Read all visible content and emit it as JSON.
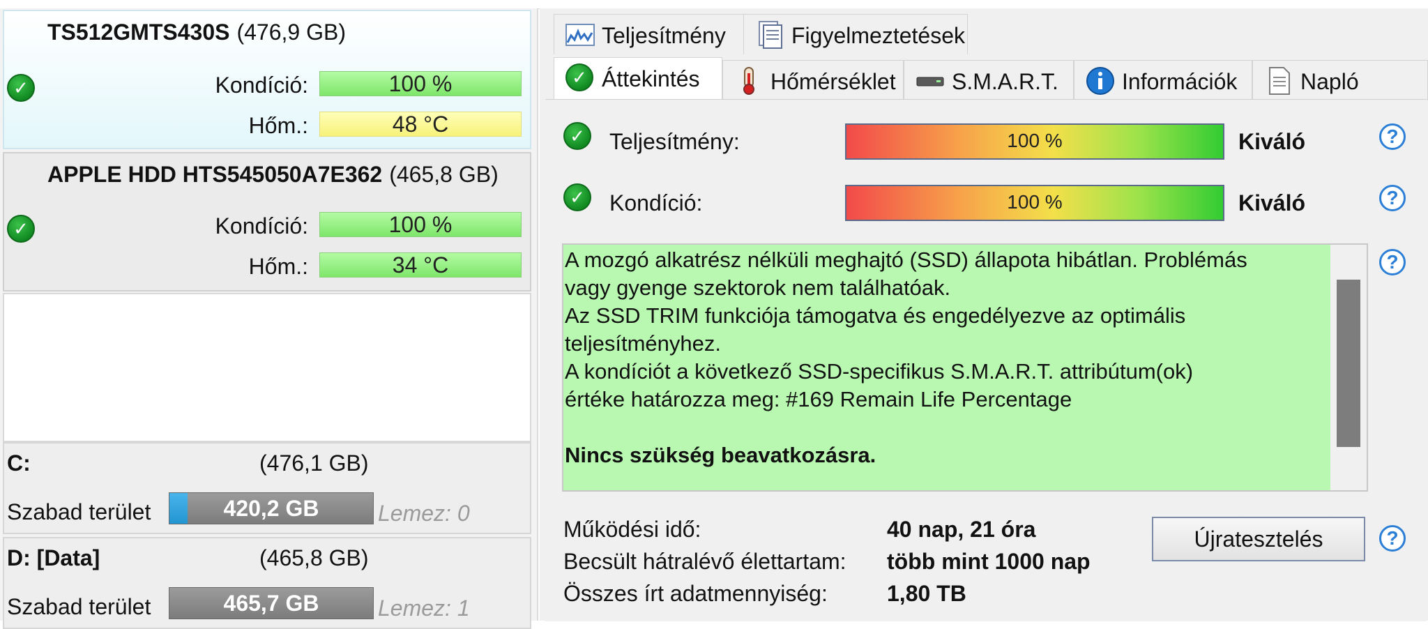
{
  "disks": [
    {
      "name": "TS512GMTS430S",
      "size": "(476,9 GB)",
      "health_label": "Kondíció:",
      "health": "100 %",
      "temp_label": "Hőm.:",
      "temp": "48 °C"
    },
    {
      "name": "APPLE HDD HTS545050A7E362",
      "size": "(465,8 GB)",
      "health_label": "Kondíció:",
      "health": "100 %",
      "temp_label": "Hőm.:",
      "temp": "34 °C"
    }
  ],
  "volumes": [
    {
      "letter": "C:",
      "size": "(476,1 GB)",
      "free_label": "Szabad terület",
      "free": "420,2 GB",
      "used_fraction": 0.088,
      "disk": "Lemez: 0"
    },
    {
      "letter": "D: [Data]",
      "size": "(465,8 GB)",
      "free_label": "Szabad terület",
      "free": "465,7 GB",
      "used_fraction": 0.0,
      "disk": "Lemez: 1"
    }
  ],
  "tabs_top": [
    {
      "label": "Teljesítmény",
      "icon": "performance-chart-icon"
    },
    {
      "label": "Figyelmeztetések",
      "icon": "document-icon"
    }
  ],
  "tabs_bottom": [
    {
      "label": "Áttekintés",
      "icon": "check-icon"
    },
    {
      "label": "Hőmérséklet",
      "icon": "thermometer-icon"
    },
    {
      "label": "S.M.A.R.T.",
      "icon": "drive-icon"
    },
    {
      "label": "Információk",
      "icon": "info-icon"
    },
    {
      "label": "Napló",
      "icon": "log-icon"
    }
  ],
  "overview": {
    "performance_label": "Teljesítmény:",
    "performance_value": "100 %",
    "performance_rating": "Kiváló",
    "health_label": "Kondíció:",
    "health_value": "100 %",
    "health_rating": "Kiváló",
    "message_lines": [
      "A mozgó alkatrész nélküli meghajtó (SSD) állapota hibátlan. Problémás",
      "vagy gyenge szektorok nem találhatóak.",
      "Az SSD TRIM funkciója támogatva és engedélyezve az optimális",
      "teljesítményhez.",
      "A kondíciót a következő SSD-specifikus S.M.A.R.T. attribútum(ok)",
      "értéke határozza meg:  #169 Remain Life Percentage"
    ],
    "message_bold": "Nincs szükség beavatkozásra.",
    "uptime_label": "Működési idő:",
    "uptime_value": "40 nap, 21 óra",
    "lifetime_label": "Becsült hátralévő élettartam:",
    "lifetime_value": "több mint 1000 nap",
    "written_label": "Összes írt adatmennyiség:",
    "written_value": "1,80 TB",
    "retest_button": "Újratesztelés",
    "help_symbol": "?"
  },
  "colors": {
    "ok_green": "#118a22",
    "help_blue": "#2b7fd6",
    "message_bg": "#b8f8b0",
    "volume_fill": "#2395d2"
  }
}
